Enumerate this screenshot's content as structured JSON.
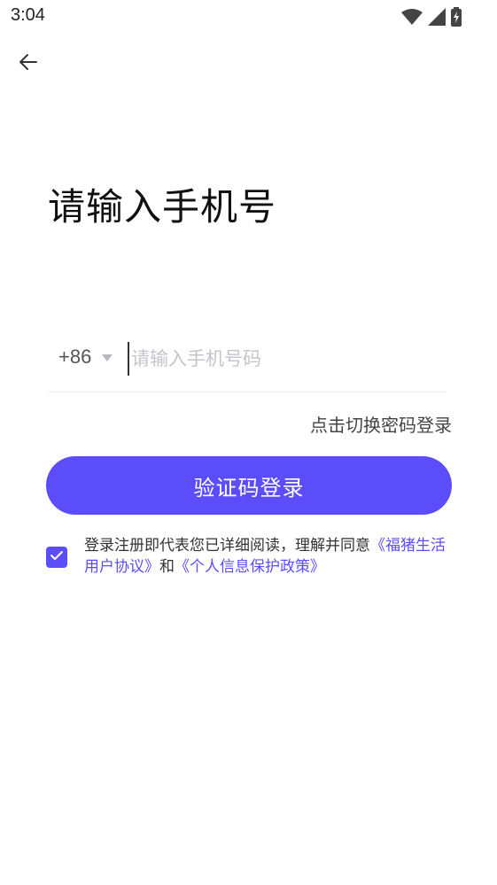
{
  "status_bar": {
    "time": "3:04",
    "icons": [
      "wifi-icon",
      "signal-icon",
      "battery-charging-icon"
    ]
  },
  "header": {
    "back_icon": "arrow-left-icon"
  },
  "title": "请输入手机号",
  "phone": {
    "country_code": "+86",
    "placeholder": "请输入手机号码",
    "value": ""
  },
  "switch_link": "点击切换密码登录",
  "login_button": "验证码登录",
  "agreement": {
    "checked": true,
    "prefix": "登录注册即代表您已详细阅读，理解并同意",
    "user_agreement": "《福猪生活用户协议》",
    "conjunction": "和",
    "privacy_policy": "《个人信息保护政策》"
  },
  "colors": {
    "accent": "#5b4dfa",
    "text": "#222222",
    "placeholder": "#c4c4cc",
    "divider": "#ececec"
  }
}
